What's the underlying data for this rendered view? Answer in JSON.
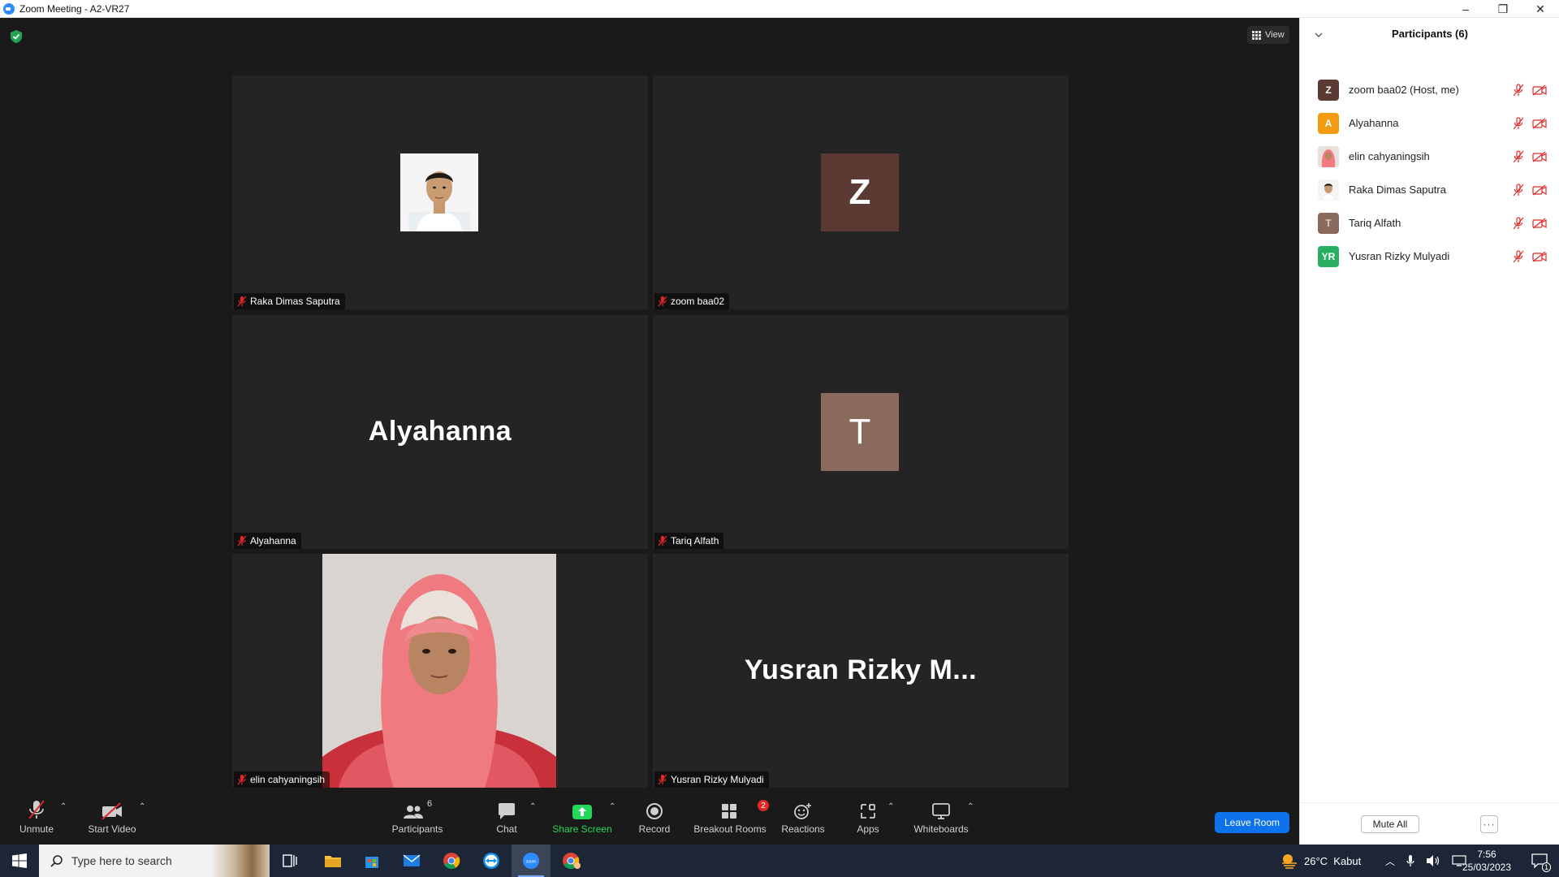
{
  "window": {
    "title": "Zoom Meeting - A2-VR27",
    "minimize": "–",
    "restore": "❐",
    "close": "✕"
  },
  "view_button": {
    "label": "View"
  },
  "tiles": [
    {
      "name": "Raka Dimas Saputra"
    },
    {
      "name": "zoom baa02",
      "initial": "Z",
      "avatar_color": "#5b3a33"
    },
    {
      "name": "Alyahanna",
      "display_name": "Alyahanna"
    },
    {
      "name": "Tariq Alfath",
      "initial": "T",
      "avatar_color": "#8b6a5e"
    },
    {
      "name": "elin cahyaningsih"
    },
    {
      "name": "Yusran Rizky Mulyadi",
      "display_name": "Yusran  Rizky  M..."
    }
  ],
  "toolbar": {
    "unmute": "Unmute",
    "start_video": "Start Video",
    "participants": "Participants",
    "participants_count": "6",
    "chat": "Chat",
    "share_screen": "Share Screen",
    "record": "Record",
    "breakout_rooms": "Breakout Rooms",
    "breakout_count": "2",
    "reactions": "Reactions",
    "apps": "Apps",
    "whiteboards": "Whiteboards",
    "leave_room": "Leave Room"
  },
  "panel": {
    "title": "Participants (6)",
    "participants": [
      {
        "name": "zoom baa02 (Host, me)",
        "initial": "Z",
        "color": "#5b3a33"
      },
      {
        "name": "Alyahanna",
        "initial": "A",
        "color": "#f39c12"
      },
      {
        "name": "elin cahyaningsih",
        "initial": "",
        "color": "#e8a0a8"
      },
      {
        "name": "Raka Dimas Saputra",
        "initial": "",
        "color": "#ffffff"
      },
      {
        "name": "Tariq Alfath",
        "initial": "T",
        "color": "#8b6a5e"
      },
      {
        "name": "Yusran Rizky Mulyadi",
        "initial": "YR",
        "color": "#27ae60"
      }
    ],
    "mute_all": "Mute All",
    "more": "···"
  },
  "taskbar": {
    "search_placeholder": "Type here to search",
    "weather": "26°C  Kabut",
    "time": "7:56",
    "date": "25/03/2023",
    "notification_count": "1"
  },
  "colors": {
    "accent": "#0e72ed",
    "share_green": "#23d959",
    "muted_red": "#e02828"
  }
}
